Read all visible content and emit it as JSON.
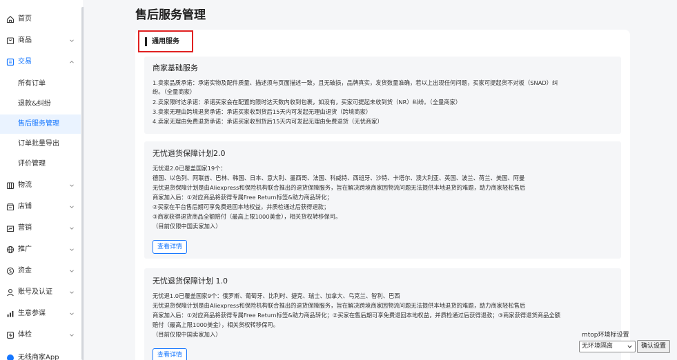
{
  "sidebar": {
    "items": [
      {
        "label": "首页",
        "icon": "home-icon"
      },
      {
        "label": "商品",
        "icon": "product-icon"
      },
      {
        "label": "交易",
        "icon": "trade-icon"
      },
      {
        "label": "物流",
        "icon": "logistics-icon"
      },
      {
        "label": "店铺",
        "icon": "store-icon"
      },
      {
        "label": "营销",
        "icon": "marketing-icon"
      },
      {
        "label": "推广",
        "icon": "promotion-icon"
      },
      {
        "label": "资金",
        "icon": "funds-icon"
      },
      {
        "label": "账号及认证",
        "icon": "account-icon"
      },
      {
        "label": "生意参谋",
        "icon": "analytics-icon"
      },
      {
        "label": "体检",
        "icon": "checkup-icon"
      },
      {
        "label": "无线商家App",
        "icon": "app-icon"
      }
    ],
    "sub_items": [
      {
        "label": "所有订单"
      },
      {
        "label": "退款&纠纷"
      },
      {
        "label": "售后服务管理"
      },
      {
        "label": "订单批量导出"
      },
      {
        "label": "评价管理"
      }
    ]
  },
  "page": {
    "title": "售后服务管理",
    "section_label": "通用服务"
  },
  "panels": [
    {
      "title": "商家基础服务",
      "lines": [
        "1.卖家品质承诺：承诺实物及配件质量、描述须与页面描述一致，且无破损，品牌真实，发货数量准确，若以上出现任何问题，买家可提起货不对板（SNAD）纠",
        "纷。（全量商家）",
        "2.卖家限时达承诺：承诺买家会在配置的限时达天数内收到包裹，如没有，买家可提起未收到货（NR）纠纷。（全量商家）",
        "3.卖家无理由跨境退货承诺：承诺买家收到货后15天内可发起无理由退货（跨境商家）",
        "4.卖家无理由免费退货承诺：承诺买家收到货后15天内可发起无理由免费退货（无忧商家）"
      ]
    },
    {
      "title": "无忧退货保障计划2.0",
      "lines": [
        "无忧退2.0已覆盖国家19个：",
        "德国、以色列、阿联酋、巴林、韩国、日本、意大利、墨西哥、法国、科威特、西班牙、沙特、卡塔尔、澳大利亚、英国、波兰、荷兰、美国、阿曼",
        "无忧退货保障计划是由Aliexpress和保险机构联合推出的退货保障服务，旨在解决跨境商家因物流问题无法提供本地退货的难题，助力商家轻松售后",
        "商家加入后：①对应商品将获得专属Free Return标签&助力商品转化；",
        "②买家在平台售后期可享免费退回本地权益，并质检通过后获得退款；",
        "③商家获得退货商品全额赔付（最高上限1000美金），相关货权转移保司。",
        "（目前仅限中国卖家加入）"
      ],
      "button": "查看详情"
    },
    {
      "title": "无忧退货保障计划 1.0",
      "lines": [
        "无忧退1.0已覆盖国家9个：俄罗斯、葡萄牙、比利时、捷克、瑞士、加拿大、乌克兰、智利、巴西",
        "无忧退货保障计划是由Aliexpress和保险机构联合推出的退货保障服务，旨在解决跨境商家因物流问题无法提供本地退货的难题，助力商家轻松售后",
        "商家加入后：①对应商品将获得专属Free Return标签&助力商品转化；②买家在售后期可享免费退回本地权益，并质检通过后获得退款；③商家获得退货商品全额",
        "赔付（最高上限1000美金），相关货权转移保司。",
        "（目前仅限中国卖家加入）"
      ],
      "button": "查看详情"
    }
  ],
  "env": {
    "label": "mtop环境标设置",
    "selected": "无环境隔离",
    "confirm": "确认设置"
  },
  "colors": {
    "accent": "#1677ff",
    "highlight_border": "#e02020",
    "panel_bg": "#f5f6f8"
  }
}
